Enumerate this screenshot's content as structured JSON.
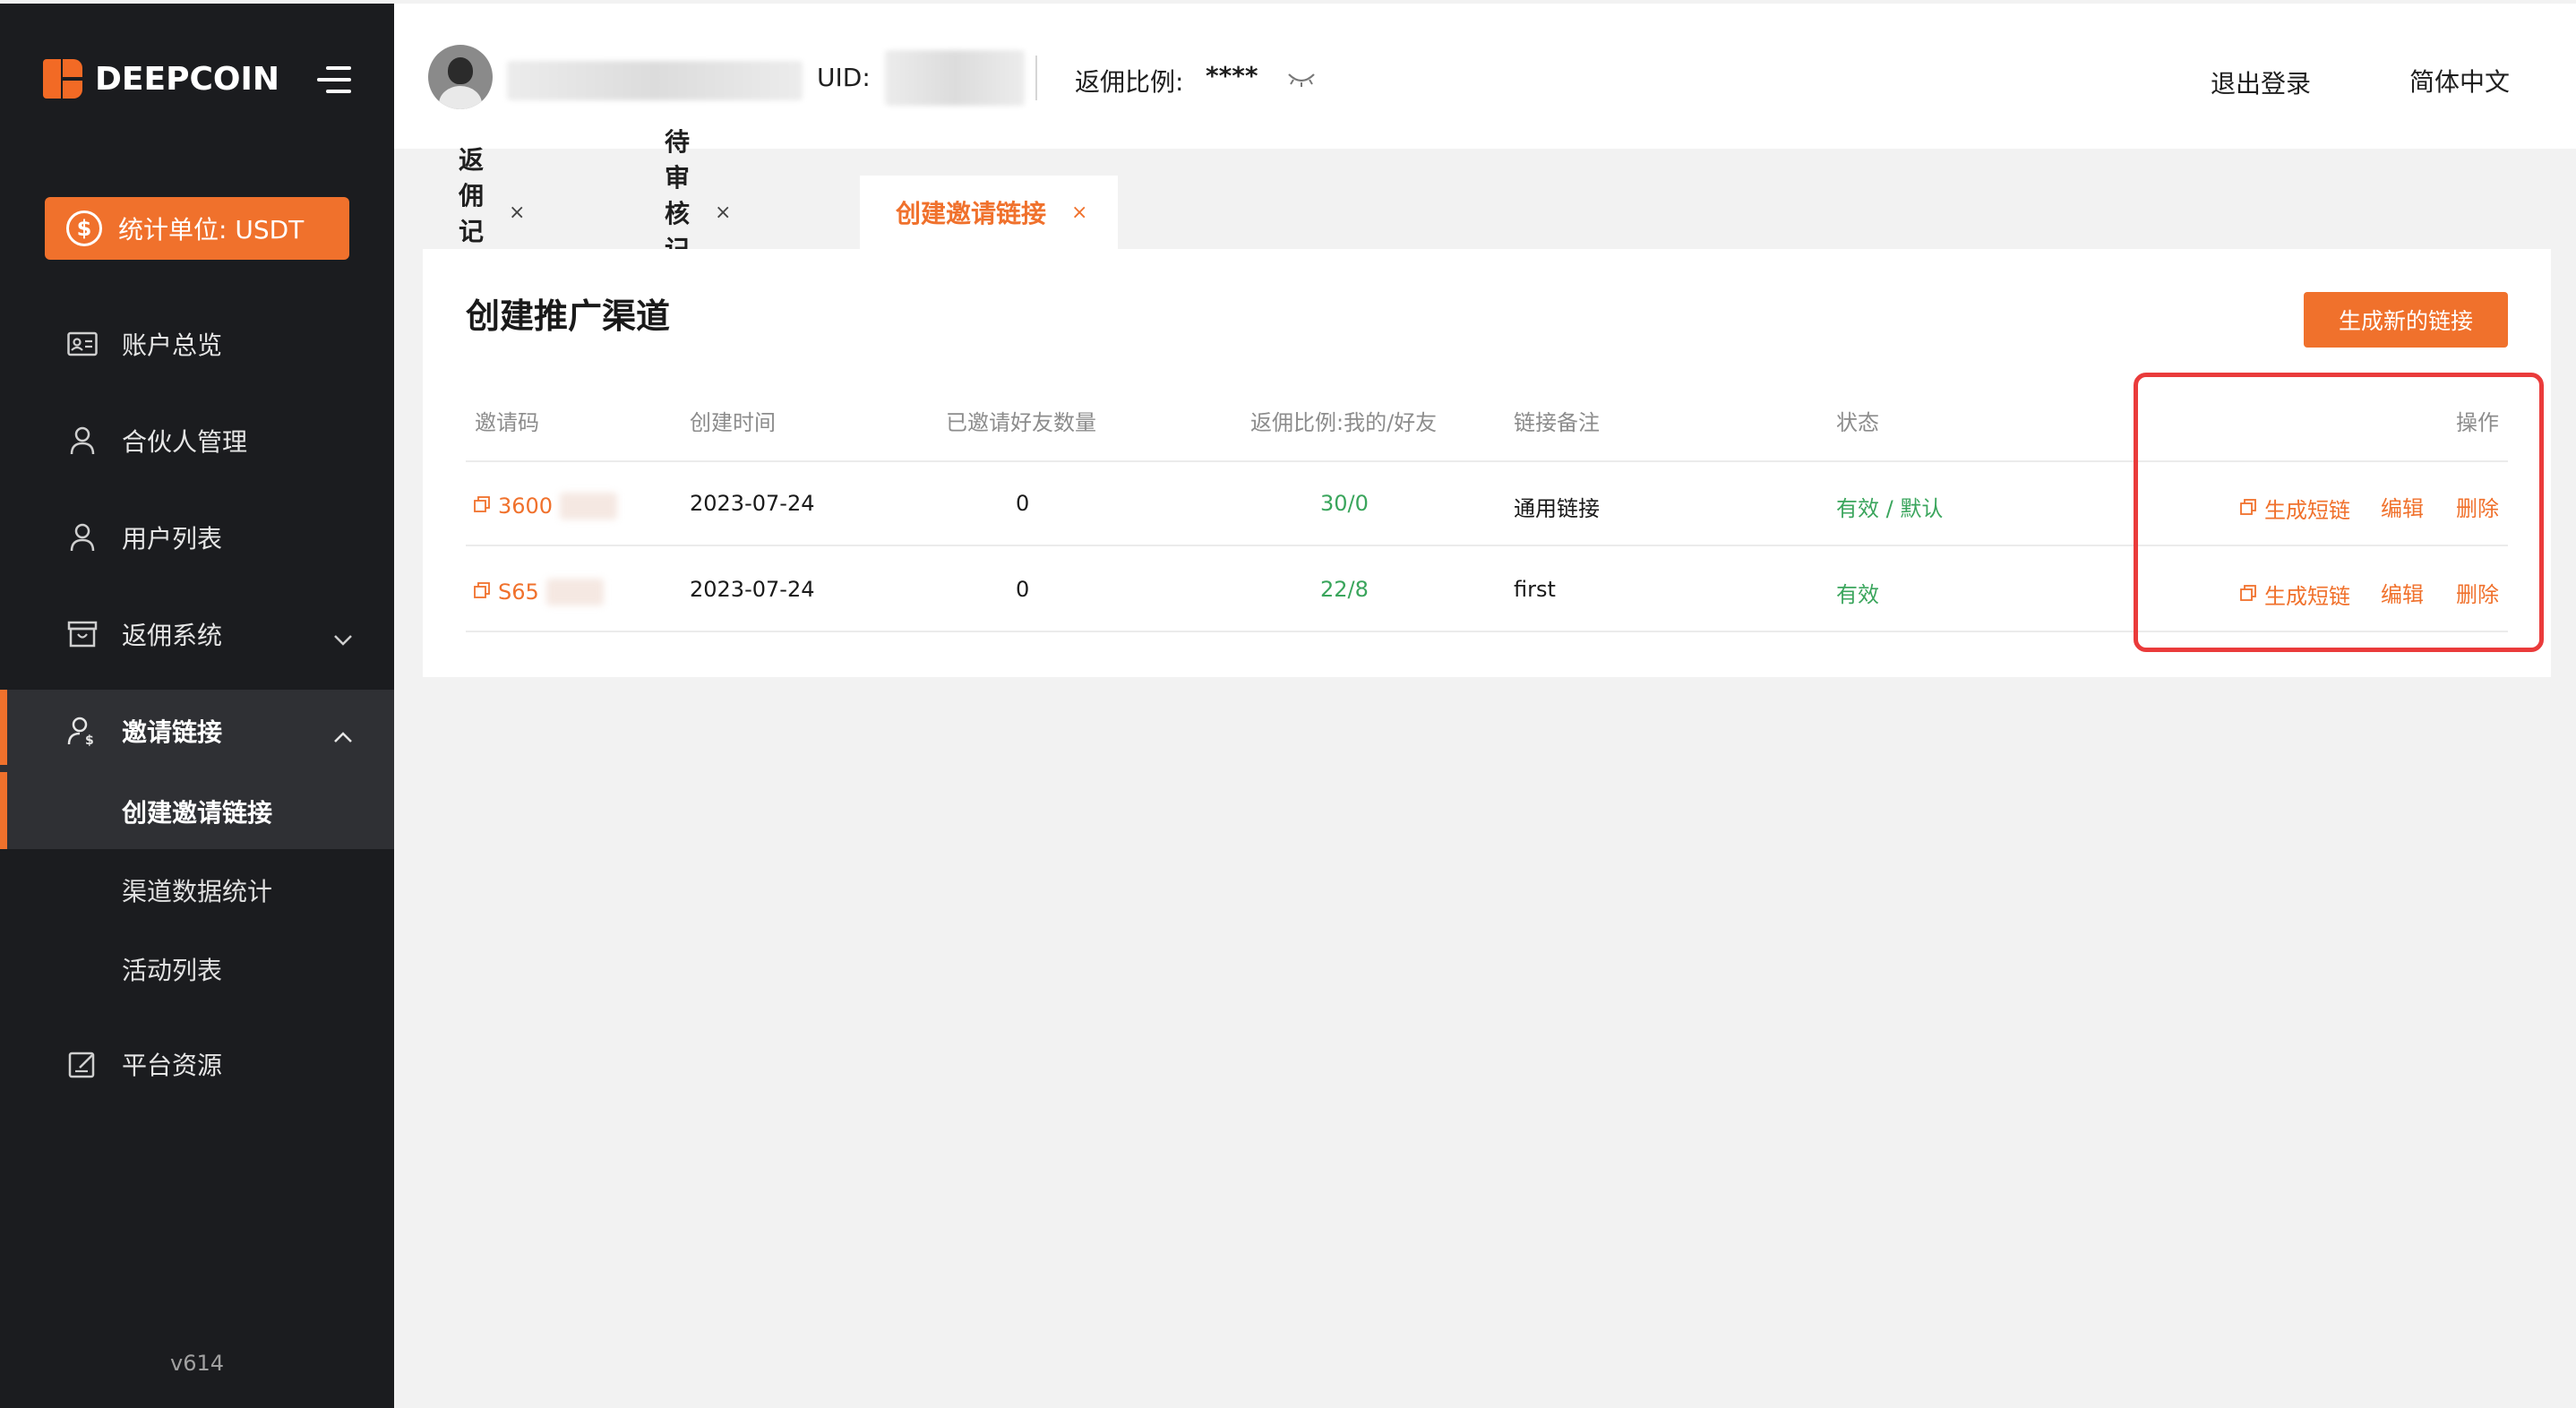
{
  "sidebar": {
    "brand": "DEEPCOIN",
    "unit_button": "统计单位:  USDT",
    "unit_icon": "dollar-icon",
    "items": [
      {
        "label": "账户总览",
        "icon": "id-card-icon"
      },
      {
        "label": "合伙人管理",
        "icon": "user-icon"
      },
      {
        "label": "用户列表",
        "icon": "user-icon"
      },
      {
        "label": "返佣系统",
        "icon": "box-icon"
      },
      {
        "label": "邀请链接",
        "icon": "user-dollar-icon"
      },
      {
        "label": "平台资源",
        "icon": "edit-icon"
      }
    ],
    "sub_items": [
      "创建邀请链接",
      "渠道数据统计",
      "活动列表"
    ],
    "version": "v614"
  },
  "header": {
    "uid_label": "UID:",
    "ratio_label": "返佣比例:",
    "ratio_value": "****",
    "logout": "退出登录",
    "language": "简体中文"
  },
  "tabs": [
    {
      "label": "返佣记录",
      "active": false
    },
    {
      "label": "待审核记录",
      "active": false
    },
    {
      "label": "创建邀请链接",
      "active": true
    }
  ],
  "tab_close": "×",
  "main": {
    "title": "创建推广渠道",
    "new_link_button": "生成新的链接",
    "columns": [
      "邀请码",
      "创建时间",
      "已邀请好友数量",
      "返佣比例:我的/好友",
      "链接备注",
      "状态",
      "操作"
    ],
    "rows": [
      {
        "code": "3600",
        "created": "2023-07-24",
        "invited": "0",
        "ratio": "30/0",
        "note": "通用链接",
        "status": "有效 / 默认"
      },
      {
        "code": "S65",
        "created": "2023-07-24",
        "invited": "0",
        "ratio": "22/8",
        "note": "first",
        "status": "有效"
      }
    ],
    "actions": {
      "short_link": "生成短链",
      "edit": "编辑",
      "delete": "删除"
    }
  },
  "colors": {
    "accent": "#f0712c",
    "sidebar_bg": "#1b1c1f",
    "green": "#3aa55c",
    "highlight": "#ea3b3b"
  }
}
